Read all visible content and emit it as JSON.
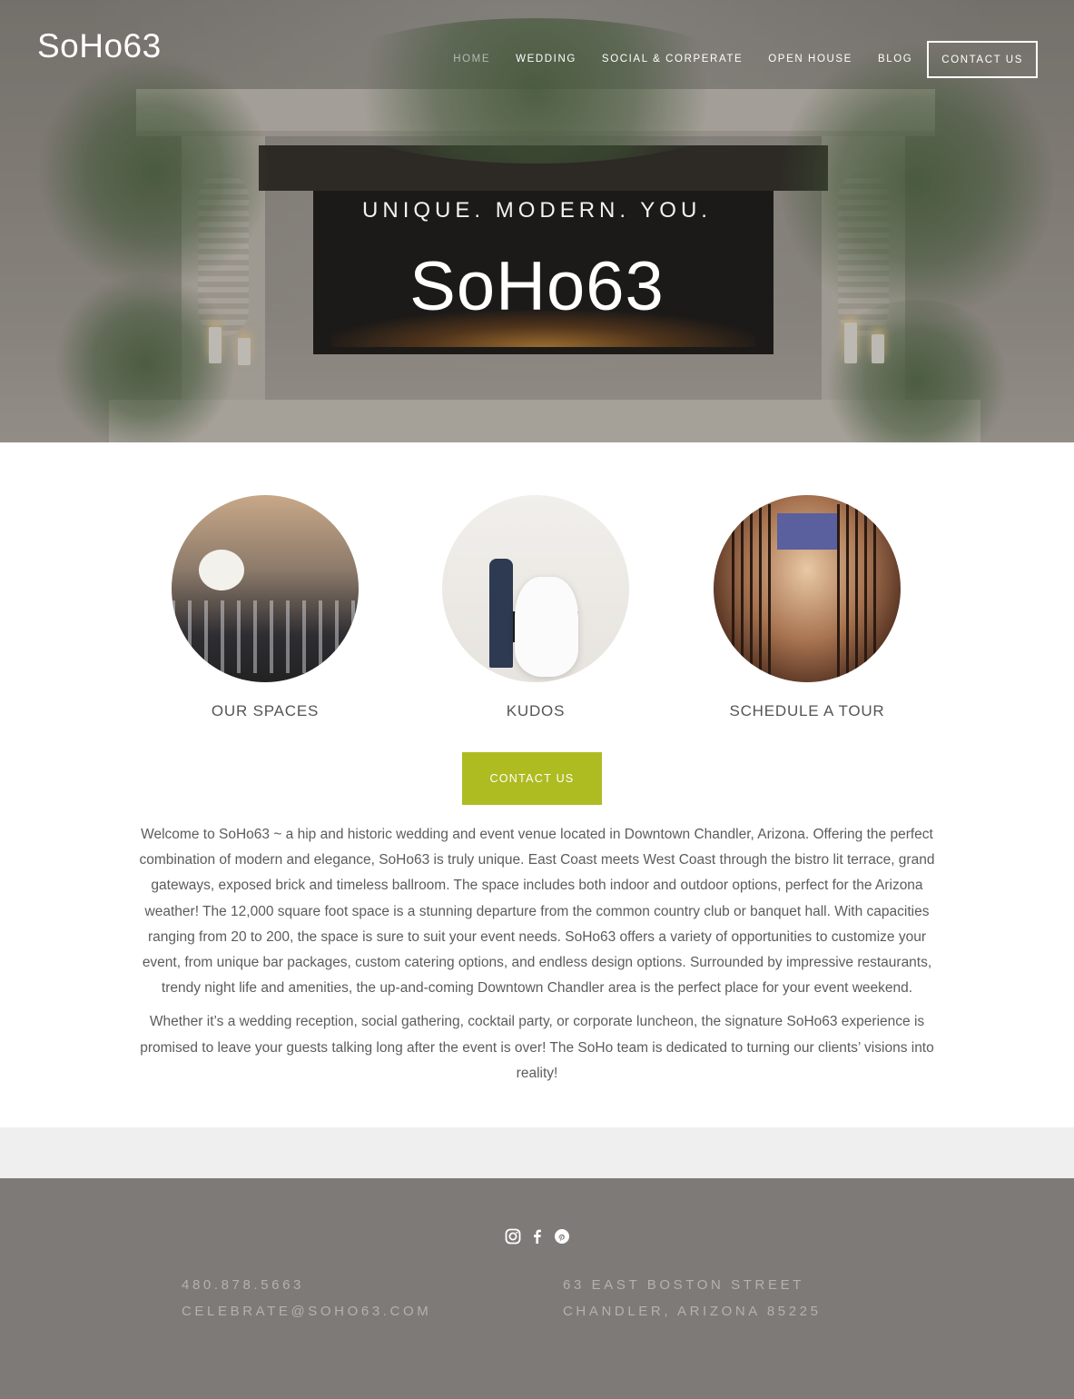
{
  "header": {
    "logo": "SoHo63",
    "nav": [
      {
        "label": "HOME",
        "active": true
      },
      {
        "label": "WEDDING",
        "active": false
      },
      {
        "label": "SOCIAL & CORPERATE",
        "active": false
      },
      {
        "label": "OPEN HOUSE",
        "active": false
      },
      {
        "label": "BLOG",
        "active": false
      }
    ],
    "contact_button": "CONTACT US"
  },
  "hero": {
    "tagline": "UNIQUE. MODERN. YOU.",
    "title": "SoHo63"
  },
  "features": [
    {
      "label": "OUR SPACES"
    },
    {
      "label": "KUDOS"
    },
    {
      "label": "SCHEDULE A TOUR"
    }
  ],
  "cta": {
    "label": "CONTACT US",
    "color": "#aebc22"
  },
  "copy": {
    "paragraph1": "Welcome to SoHo63 ~ a hip and historic wedding and event venue located in Downtown Chandler, Arizona. Offering the perfect combination of modern and elegance, SoHo63 is truly unique. East Coast meets West Coast through the bistro lit terrace, grand gateways, exposed brick and timeless ballroom. The space includes both indoor and outdoor options, perfect for the Arizona weather! The 12,000 square foot space is a stunning departure from the common country club or banquet hall. With capacities ranging from 20 to 200, the space is sure to suit your event needs. SoHo63 offers a variety of opportunities to customize your event, from unique bar packages, custom catering options, and endless design options. Surrounded by impressive restaurants, trendy night life and amenities, the up-and-coming Downtown Chandler area is the perfect place for your event weekend.",
    "paragraph2": "Whether it’s a wedding reception, social gathering, cocktail party, or corporate luncheon, the signature SoHo63 experience is promised to leave your guests talking long after the event is over! The SoHo team is dedicated to turning our clients’ visions into reality!"
  },
  "footer": {
    "social_icons": [
      "instagram-icon",
      "facebook-icon",
      "pinterest-icon"
    ],
    "phone": "480.878.5663",
    "email": "CELEBRATE@SOHO63.COM",
    "address_line1": "63 EAST BOSTON STREET",
    "address_line2": "CHANDLER, ARIZONA 85225",
    "background": "#7e7a77"
  }
}
